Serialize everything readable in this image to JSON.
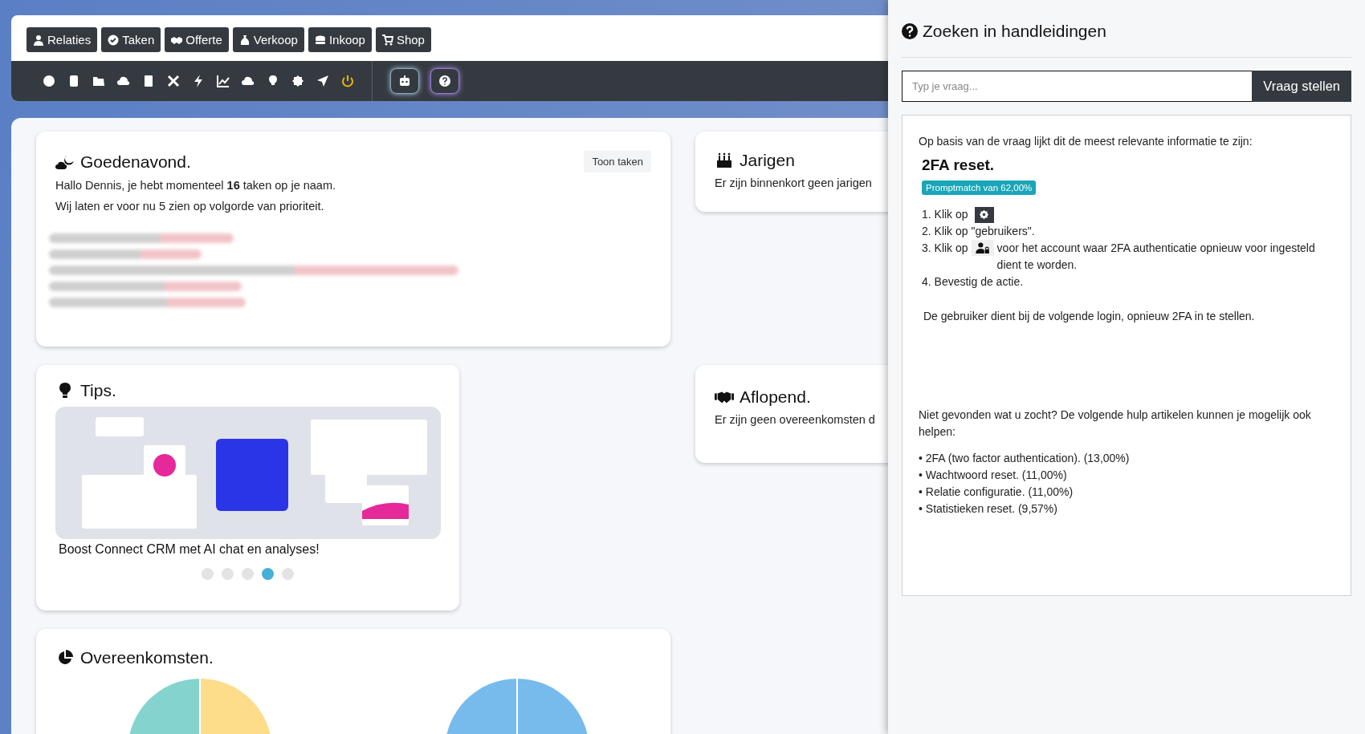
{
  "nav_buttons": [
    {
      "label": "Relaties"
    },
    {
      "label": "Taken"
    },
    {
      "label": "Offerte"
    },
    {
      "label": "Verkoop"
    },
    {
      "label": "Inkoop"
    },
    {
      "label": "Shop"
    }
  ],
  "greeting": {
    "title": "Goedenavond.",
    "button": "Toon taken",
    "line_1": "Hallo Dennis, je hebt momenteel **16** taken op je naam.",
    "line_2": "Wij laten er voor nu 5 zien op volgorde van prioriteit."
  },
  "birthdays": {
    "title": "Jarigen",
    "text": "Er zijn binnenkort geen jarigen"
  },
  "tips": {
    "title": "Tips.",
    "caption": "Boost Connect CRM met AI chat en analyses!",
    "dots": [
      {
        "selected": false
      },
      {
        "selected": false
      },
      {
        "selected": false
      },
      {
        "selected": true
      },
      {
        "selected": false
      }
    ]
  },
  "expiring": {
    "title": "Aflopend.",
    "text": "Er zijn geen overeenkomsten d"
  },
  "agreements": {
    "title": "Overeenkomsten."
  },
  "help_panel": {
    "title": "Zoeken in handleidingen",
    "search": {
      "placeholder": "Typ je vraag..."
    },
    "ask_button": "Vraag stellen",
    "intro": "Op basis van de vraag lijkt dit de meest relevante informatie te zijn:",
    "result_title": "2FA reset.",
    "match_badge": "Promptmatch van 62,00%",
    "steps": [
      {
        "kind": "gear",
        "text": "1. Klik op"
      },
      {
        "kind": "plain",
        "text": "2. Klik op \"gebruikers\"."
      },
      {
        "kind": "user-lock",
        "text": "3. Klik op",
        "after": "voor het account waar 2FA authenticatie opnieuw voor ingesteld dient te worden."
      },
      {
        "kind": "plain",
        "text": "4. Bevestig de actie."
      }
    ],
    "note": "De gebruiker dient bij de volgende login, opnieuw 2FA in te stellen.",
    "more_intro": "Niet gevonden wat u zocht? De volgende hulp artikelen kunnen je mogelijk ook helpen:",
    "articles": [
      "• 2FA (two factor authentication). (13,00%)",
      "• Wachtwoord reset. (11,00%)",
      "• Relatie configuratie. (11,00%)",
      "• Statistieken reset. (9,57%)"
    ]
  }
}
